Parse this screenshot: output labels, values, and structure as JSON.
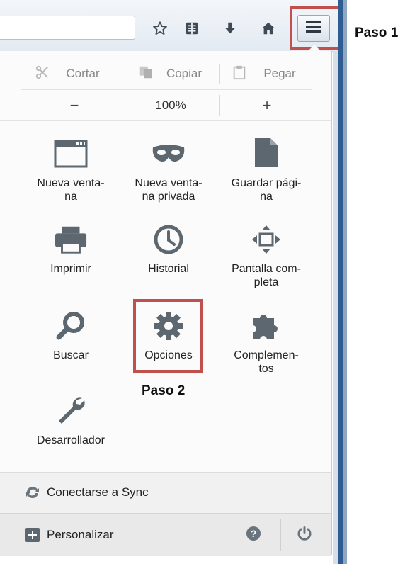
{
  "toolbar": {
    "url_value": "",
    "icons": [
      "star-icon",
      "reading-list-icon",
      "download-icon",
      "home-icon",
      "hamburger-menu-icon"
    ]
  },
  "annotations": {
    "step1": "Paso 1",
    "step2": "Paso 2"
  },
  "edit_row": {
    "cut": "Cortar",
    "copy": "Copiar",
    "paste": "Pegar"
  },
  "zoom_row": {
    "zoom_out": "−",
    "zoom_level": "100%",
    "zoom_in": "+"
  },
  "tiles": [
    {
      "label_line1": "Nueva venta-",
      "label_line2": "na",
      "icon": "window-icon"
    },
    {
      "label_line1": "Nueva venta-",
      "label_line2": "na privada",
      "icon": "mask-icon"
    },
    {
      "label_line1": "Guardar pági-",
      "label_line2": "na",
      "icon": "page-icon"
    },
    {
      "label_line1": "Imprimir",
      "label_line2": "",
      "icon": "printer-icon"
    },
    {
      "label_line1": "Historial",
      "label_line2": "",
      "icon": "clock-icon"
    },
    {
      "label_line1": "Pantalla com-",
      "label_line2": "pleta",
      "icon": "fullscreen-icon"
    },
    {
      "label_line1": "Buscar",
      "label_line2": "",
      "icon": "search-icon"
    },
    {
      "label_line1": "Opciones",
      "label_line2": "",
      "icon": "gear-icon"
    },
    {
      "label_line1": "Complemen-",
      "label_line2": "tos",
      "icon": "puzzle-icon"
    },
    {
      "label_line1": "Desarrollador",
      "label_line2": "",
      "icon": "wrench-icon"
    }
  ],
  "footer": {
    "sync": "Conectarse a Sync",
    "customize": "Personalizar"
  },
  "colors": {
    "highlight": "#c0504d",
    "icon_gray": "#5c6770",
    "toolbar_icon": "#3f4a55"
  }
}
